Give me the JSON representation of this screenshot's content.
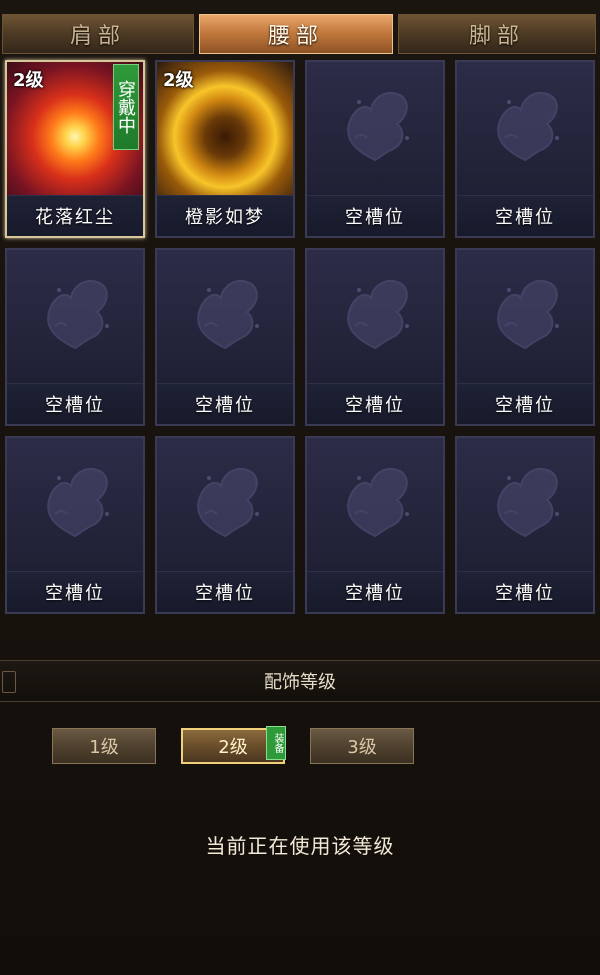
{
  "tabs": [
    "肩部",
    "腰部",
    "脚部"
  ],
  "active_tab": 1,
  "slots": [
    {
      "name": "花落红尘",
      "level": "2级",
      "wearing": "穿戴中",
      "art": "art-red"
    },
    {
      "name": "橙影如梦",
      "level": "2级",
      "wearing": "",
      "art": "art-gold"
    },
    {
      "name": "空槽位"
    },
    {
      "name": "空槽位"
    },
    {
      "name": "空槽位"
    },
    {
      "name": "空槽位"
    },
    {
      "name": "空槽位"
    },
    {
      "name": "空槽位"
    },
    {
      "name": "空槽位"
    },
    {
      "name": "空槽位"
    },
    {
      "name": "空槽位"
    },
    {
      "name": "空槽位"
    }
  ],
  "section_title": "配饰等级",
  "levels": [
    "1级",
    "2级",
    "3级"
  ],
  "active_level": 1,
  "level_badge": "装备",
  "status": "当前正在使用该等级",
  "colors": {
    "active_tab": "#c47a3e",
    "wearing_badge": "#2f9a3a",
    "slot_bg": "#222238"
  }
}
